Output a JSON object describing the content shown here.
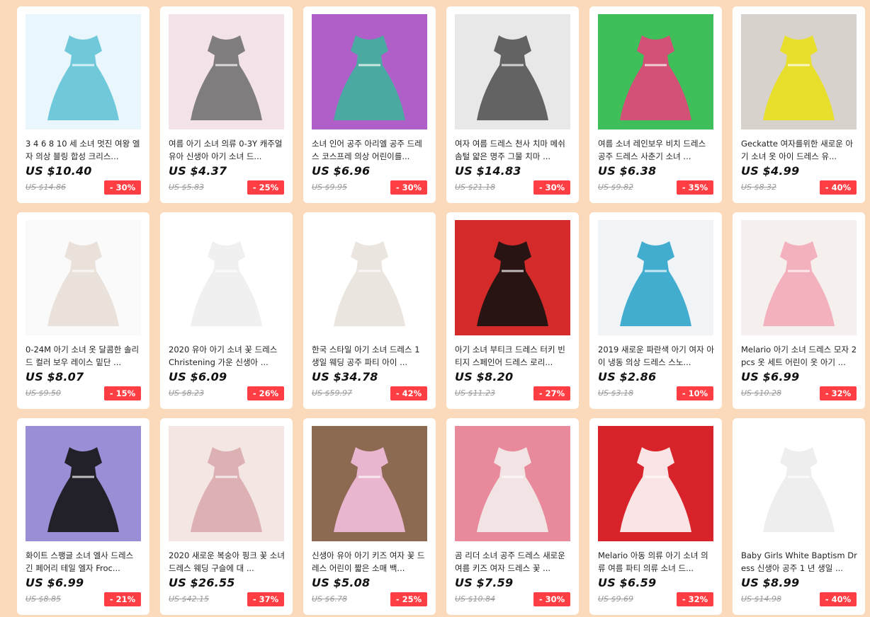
{
  "products": [
    {
      "title": "3 4 6 8 10 세 소녀 멋진 여왕 엘자 의상 블링 합성 크리스...",
      "price": "US $10.40",
      "original_price": "US $14.86",
      "discount": "- 30%",
      "image": "frozen-elsa-dress-accessories",
      "colors": [
        "#5ec3d6",
        "#e9f6fb"
      ]
    },
    {
      "title": "여름 아기 소녀 의류 0-3Y 캐주얼 유아 신생아 아기 소녀 드...",
      "price": "US $4.37",
      "original_price": "US $5.83",
      "discount": "- 25%",
      "image": "checkered-baby-dress-on-hanger",
      "colors": [
        "#6e6e6e",
        "#f3e3e8"
      ]
    },
    {
      "title": "소녀 인어 공주 아리엘 공주 드레스 코스프레 의상 어린이를...",
      "price": "US $6.96",
      "original_price": "US $9.95",
      "discount": "- 30%",
      "image": "mermaid-costume-dresses",
      "colors": [
        "#3bb59c",
        "#b05fc8"
      ]
    },
    {
      "title": "여자 여름 드레스 천사 치마 메쉬 솜털 얇은 명주 그물 치마 ...",
      "price": "US $14.83",
      "original_price": "US $21.18",
      "discount": "- 30%",
      "image": "girl-white-tulle-skirt",
      "colors": [
        "#505050",
        "#e8e8e8"
      ]
    },
    {
      "title": "여름 소녀 레인보우 비치 드레스 공주 드레스 사춘기 소녀 ...",
      "price": "US $6.38",
      "original_price": "US $9.82",
      "discount": "- 35%",
      "image": "rainbow-beach-dresses",
      "colors": [
        "#e8417a",
        "#3fbf5a"
      ]
    },
    {
      "title": "Geckatte 여자를위한 새로운 아기 소녀 옷 아이 드레스 유...",
      "price": "US $4.99",
      "original_price": "US $8.32",
      "discount": "- 40%",
      "image": "yellow-girl-dress",
      "colors": [
        "#e9e016",
        "#d8d2cc"
      ]
    },
    {
      "title": "0-24M 아기 소녀 옷 달콤한 솔리드 컬러 보우 레이스 밑단 ...",
      "price": "US $8.07",
      "original_price": "US $9.50",
      "discount": "- 15%",
      "image": "baby-in-white-dress",
      "colors": [
        "#e6ddd5",
        "#fafafa"
      ]
    },
    {
      "title": "2020 유아 아기 소녀 꽃 드레스 Christening 가운 신생아 ...",
      "price": "US $6.09",
      "original_price": "US $8.23",
      "discount": "- 26%",
      "image": "white-christening-gown",
      "colors": [
        "#eeeeee",
        "#ffffff"
      ]
    },
    {
      "title": "한국 스타일 아기 소녀 드레스 1 생일 웨딩 공주 파티 아이 ...",
      "price": "US $34.78",
      "original_price": "US $59.97",
      "discount": "- 42%",
      "image": "white-princess-dress-mannequin",
      "colors": [
        "#e7e1da",
        "#ffffff"
      ]
    },
    {
      "title": "아기 소녀 부티크 드레스 터키 빈티지 스페인어 드레스 로리...",
      "price": "US $8.20",
      "original_price": "US $11.23",
      "discount": "- 27%",
      "image": "vintage-spanish-dresses",
      "colors": [
        "#111111",
        "#d42a2a"
      ]
    },
    {
      "title": "2019 새로운 파란색 아기 여자 아이 냉동 의상 드레스 스노...",
      "price": "US $2.86",
      "original_price": "US $3.18",
      "discount": "- 10%",
      "image": "blue-frozen-costume",
      "colors": [
        "#2aa3c9",
        "#f0f4f7"
      ]
    },
    {
      "title": "Melario 아기 소녀 드레스 모자 2pcs 옷 세트 어린이 옷 아기 ...",
      "price": "US $6.99",
      "original_price": "US $10.28",
      "discount": "- 32%",
      "image": "pink-dot-dress-with-hat",
      "colors": [
        "#f2a7b7",
        "#f5f0ee"
      ]
    },
    {
      "title": "화이트 스팽글 소녀 엘사 드레스 긴 페어리 테일 엘자 Froc...",
      "price": "US $6.99",
      "original_price": "US $8.85",
      "discount": "- 21%",
      "image": "white-purple-elsa-dress",
      "colors": [
        "#111111",
        "#9a8fd6"
      ]
    },
    {
      "title": "2020 새로운 복숭아 핑크 꽃 소녀 드레스 웨딩 구슬에 대 ...",
      "price": "US $26.55",
      "original_price": "US $42.15",
      "discount": "- 37%",
      "image": "peach-pink-bow-dress",
      "colors": [
        "#d9a9ad",
        "#f3e6e3"
      ]
    },
    {
      "title": "신생아 유아 아기 키즈 여자 꽃 드레스 어린이 짧은 소매 백...",
      "price": "US $5.08",
      "original_price": "US $6.78",
      "discount": "- 25%",
      "image": "pink-tutu-dress",
      "colors": [
        "#f7bfe0",
        "#8c6a52"
      ]
    },
    {
      "title": "곰 리더 소녀 공주 드레스 새로운 여름 키즈 여자 드레스 꽃 ...",
      "price": "US $7.59",
      "original_price": "US $10.84",
      "discount": "- 30%",
      "image": "floral-dress-pink-belt",
      "colors": [
        "#f3f0ee",
        "#e88a9c"
      ]
    },
    {
      "title": "Melario 아동 의류 아기 소녀 의류 여름 파티 의류 소녀 드...",
      "price": "US $6.59",
      "original_price": "US $9.69",
      "discount": "- 32%",
      "image": "cherry-dress-red-bow",
      "colors": [
        "#ffffff",
        "#d8232a"
      ]
    },
    {
      "title": "Baby Girls White Baptism Dress 신생아 공주 1 년 생일 ...",
      "price": "US $8.99",
      "original_price": "US $14.98",
      "discount": "- 40%",
      "image": "white-baptism-dress",
      "colors": [
        "#ececec",
        "#ffffff"
      ]
    }
  ]
}
